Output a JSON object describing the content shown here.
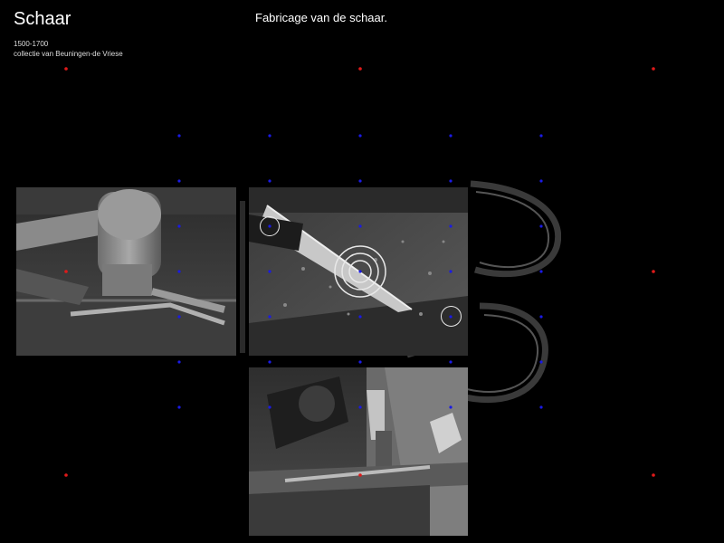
{
  "object": {
    "title": "Schaar",
    "date": "1500-1700",
    "collection": "collectie van Beuningen-de Vriese"
  },
  "section": {
    "heading": "Fabricage van de schaar."
  },
  "colors": {
    "background": "#000000",
    "grid_dot_blue": "#1a1ae6",
    "grid_dot_red": "#e01a1a",
    "hotspot_ring": "#e8e8e8"
  },
  "media": [
    {
      "name": "hammer-photo",
      "description_icon": "hammer-icon"
    },
    {
      "name": "blade-on-anvil-photo",
      "description_icon": "blade-icon"
    },
    {
      "name": "blacksmith-forging-photo",
      "description_icon": "forge-icon"
    }
  ]
}
